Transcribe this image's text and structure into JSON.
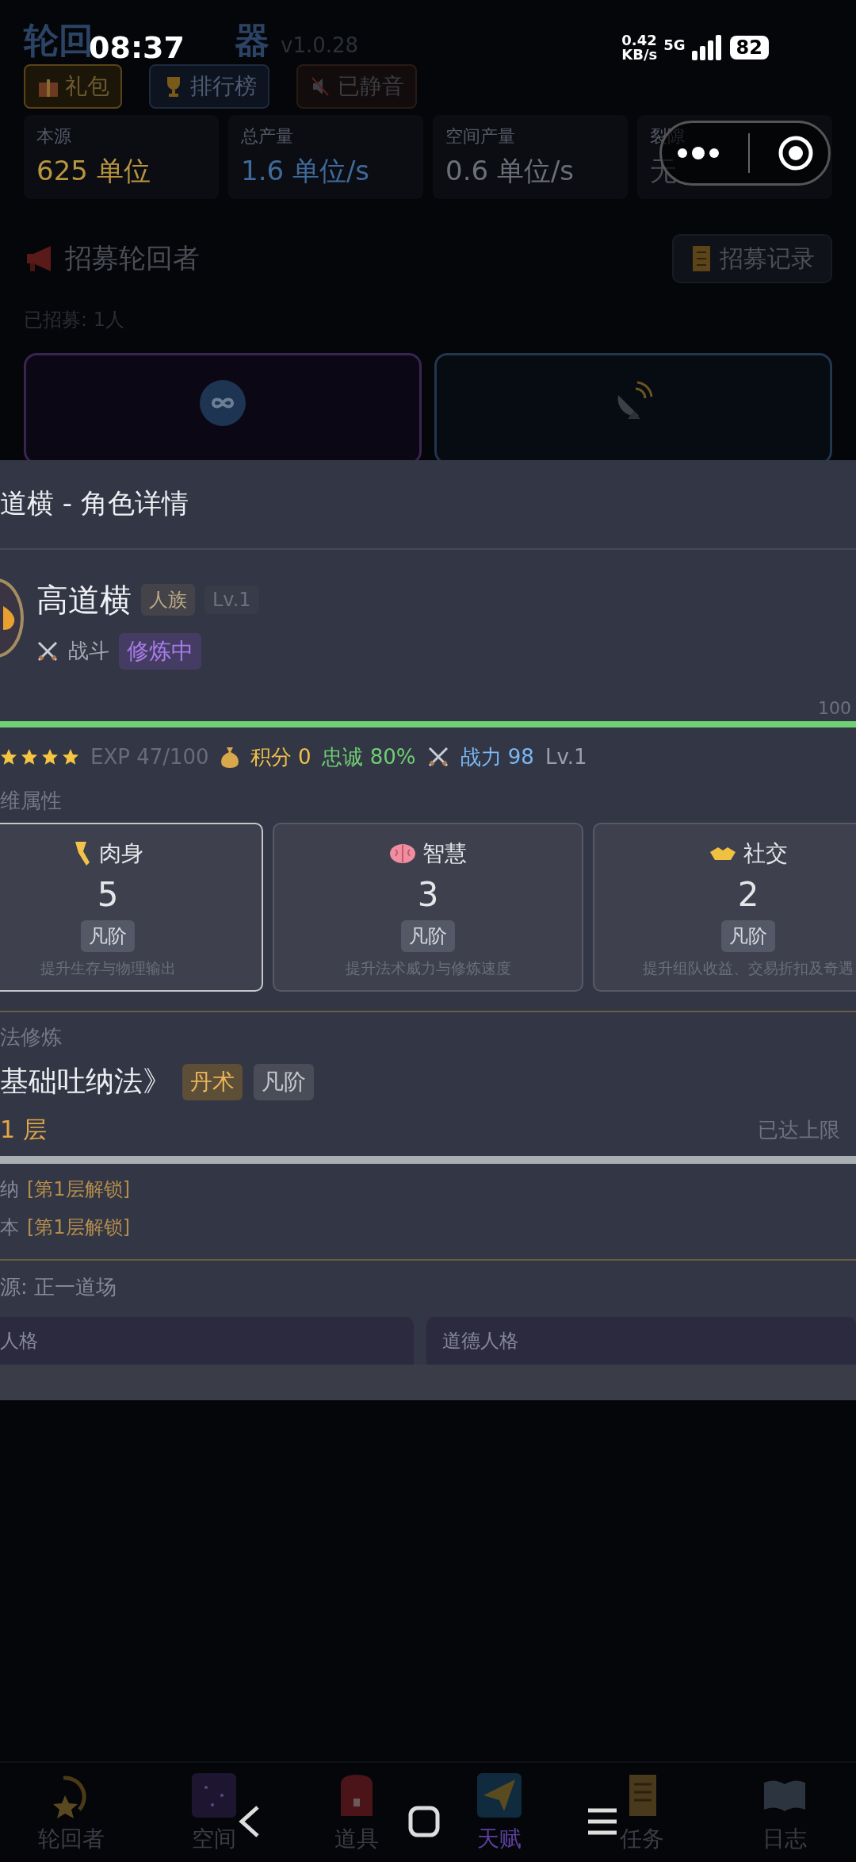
{
  "status_bar": {
    "time": "08:37",
    "net_speed": "0.42",
    "net_unit": "KB/s",
    "network": "5G",
    "battery": "82"
  },
  "app": {
    "title_start": "轮回",
    "title_end": "器",
    "version": "v1.0.28",
    "buttons": [
      {
        "label": "礼包",
        "kind": "gift"
      },
      {
        "label": "排行榜",
        "kind": "trophy"
      },
      {
        "label": "已静音",
        "kind": "mute"
      }
    ],
    "stats": [
      {
        "label": "本源",
        "value": "625 单位",
        "color": "#b8953f"
      },
      {
        "label": "总产量",
        "value": "1.6 单位/s",
        "color": "#3f6a9c"
      },
      {
        "label": "空间产量",
        "value": "0.6 单位/s",
        "color": "#6b6f78"
      },
      {
        "label": "裂隙",
        "value": "无",
        "color": "#4a4d55"
      }
    ]
  },
  "recruit": {
    "title": "招募轮回者",
    "record_button": "招募记录",
    "count": "已招募: 1人",
    "cards": [
      {
        "kind": "infinity"
      },
      {
        "kind": "satellite"
      }
    ]
  },
  "modal": {
    "title": "道横 - 角色详情",
    "character": {
      "name": "高道横",
      "race": "人族",
      "level": "Lv.1",
      "role": "战斗",
      "status": "修炼中"
    },
    "exp_bar": {
      "max_label": "100",
      "level": 1.0
    },
    "summary": {
      "stars": 4,
      "exp": "EXP 47/100",
      "points": "积分 0",
      "loyalty": "忠诚 80%",
      "power": "战力 98",
      "level": "Lv.1"
    },
    "attributes": {
      "heading": "维属性",
      "cards": [
        {
          "kind": "body",
          "name": "肉身",
          "value": "5",
          "rank": "凡阶",
          "desc": "提升生存与物理输出",
          "selected": true
        },
        {
          "kind": "mind",
          "name": "智慧",
          "value": "3",
          "rank": "凡阶",
          "desc": "提升法术威力与修炼速度",
          "selected": false
        },
        {
          "kind": "social",
          "name": "社交",
          "value": "2",
          "rank": "凡阶",
          "desc": "提升组队收益、交易折扣及奇遇",
          "selected": false
        }
      ]
    },
    "cultivation": {
      "heading": "法修炼",
      "technique": "基础吐纳法》",
      "tags": [
        {
          "label": "丹术",
          "kind": "gold"
        },
        {
          "label": "凡阶",
          "kind": "gray"
        }
      ],
      "layer": "1 层",
      "limit": "已达上限",
      "level": 1.0,
      "skills": [
        {
          "name": "纳",
          "unlock": "[第1层解锁]"
        },
        {
          "name": "本",
          "unlock": "[第1层解锁]"
        }
      ]
    },
    "source": "源: 正一道场",
    "personality": [
      {
        "label": "人格"
      },
      {
        "label": "道德人格"
      }
    ]
  },
  "nav": [
    {
      "label": "轮回者",
      "kind": "comet",
      "selected": false
    },
    {
      "label": "空间",
      "kind": "galaxy",
      "selected": false
    },
    {
      "label": "道具",
      "kind": "backpack",
      "selected": false
    },
    {
      "label": "天赋",
      "kind": "star",
      "selected": true
    },
    {
      "label": "任务",
      "kind": "scroll",
      "selected": false
    },
    {
      "label": "日志",
      "kind": "book",
      "selected": false
    }
  ]
}
